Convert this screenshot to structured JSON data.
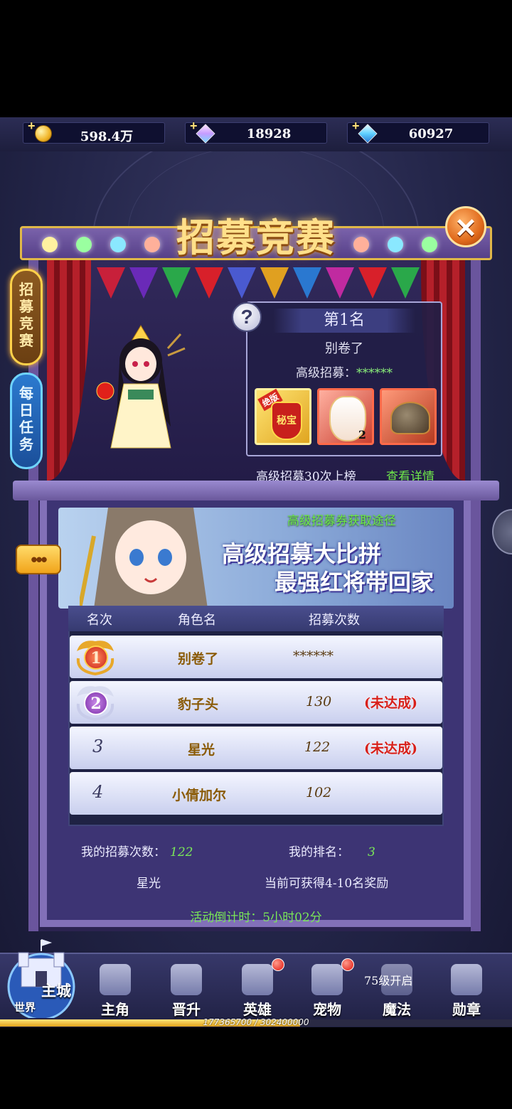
{
  "resources": [
    {
      "icon": "gold-coin-icon",
      "value": "598.4万"
    },
    {
      "icon": "pink-diamond-icon",
      "value": "18928"
    },
    {
      "icon": "blue-diamond-icon",
      "value": "60927"
    }
  ],
  "header": {
    "title": "招募竞赛"
  },
  "side_tabs": [
    {
      "label": "招募竞赛",
      "active": true
    },
    {
      "label": "每日任务",
      "active": false
    }
  ],
  "first_place": {
    "title": "第1名",
    "player": "别卷了",
    "stat_label": "高级招募：",
    "stat_value": "******",
    "rewards": [
      {
        "icon": "secret-treasure-icon",
        "tag": "绝版",
        "badge": "秘宝"
      },
      {
        "icon": "hero-portrait-icon",
        "count": "2"
      },
      {
        "icon": "helmet-icon"
      }
    ],
    "note": "高级招募30次上榜",
    "detail_link": "查看详情"
  },
  "banner": {
    "subtitle": "高级招募券获取途径",
    "line1": "高级招募大比拼",
    "line2": "最强红将带回家",
    "chat_dots": "•••"
  },
  "table": {
    "headers": [
      "名次",
      "角色名",
      "招募次数"
    ],
    "rows": [
      {
        "rank": "1",
        "name": "别卷了",
        "count": "******",
        "status": ""
      },
      {
        "rank": "2",
        "name": "豹子头",
        "count": "130",
        "status": "(未达成)"
      },
      {
        "rank": "3",
        "name": "星光",
        "count": "122",
        "status": "(未达成)"
      },
      {
        "rank": "4",
        "name": "小倩加尔",
        "count": "102",
        "status": ""
      }
    ]
  },
  "my_info": {
    "count_label": "我的招募次数：",
    "count_value": "122",
    "rank_label": "我的排名：",
    "rank_value": "3",
    "player_name": "星光",
    "reward_note": "当前可获得4-10名奖励"
  },
  "countdown": "活动倒计时：5小时02分",
  "nav": {
    "castle_main": "主城",
    "castle_world": "世界",
    "items": [
      {
        "label": "主角",
        "icon": "protagonist-icon",
        "dot": false
      },
      {
        "label": "晋升",
        "icon": "promotion-icon",
        "dot": false
      },
      {
        "label": "英雄",
        "icon": "hero-icon",
        "dot": true
      },
      {
        "label": "宠物",
        "icon": "pet-icon",
        "dot": true
      },
      {
        "label": "魔法",
        "icon": "magic-icon",
        "dot": false
      },
      {
        "label": "勋章",
        "icon": "medal-icon",
        "dot": false
      }
    ],
    "level_note": "75级开启"
  },
  "exp": {
    "text": "177365700 / 302400000",
    "fraction": 0.5865
  },
  "colors": {
    "accent_gold": "#ffe08a",
    "stage_purple": "#6a559d",
    "highlight_green": "#7ae858",
    "warning_red": "#d8201a"
  }
}
